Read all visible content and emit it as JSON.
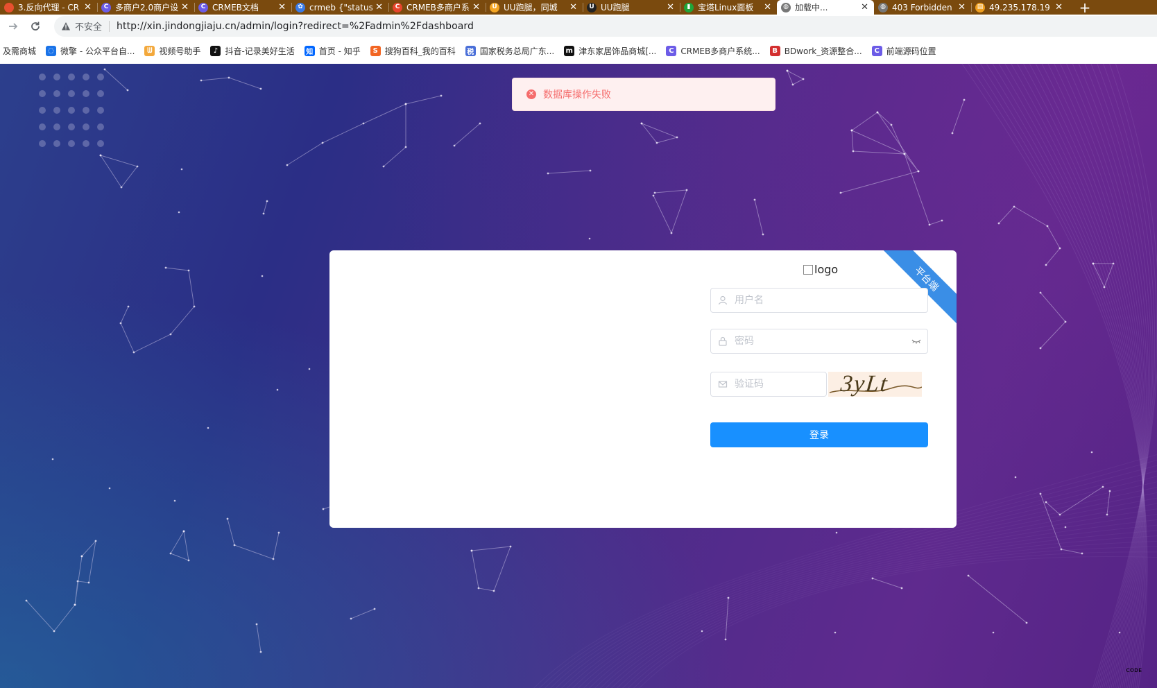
{
  "browser": {
    "tabs": [
      {
        "title": "3.反向代理 - CR",
        "icon": "crmeb-icon",
        "color": "#e8502f",
        "glyph": "",
        "active": false
      },
      {
        "title": "多商户2.0商户设",
        "icon": "crmeb-icon",
        "color": "#6c5ce7",
        "glyph": "C",
        "active": false
      },
      {
        "title": "CRMEB文档",
        "icon": "crmeb-icon",
        "color": "#6c5ce7",
        "glyph": "C",
        "active": false
      },
      {
        "title": "crmeb {\"status",
        "icon": "paw-icon",
        "color": "#3b7be6",
        "glyph": "✿",
        "active": false
      },
      {
        "title": "CRMEB多商户系",
        "icon": "crmeb-icon",
        "color": "#e8452c",
        "glyph": "C",
        "active": false
      },
      {
        "title": "UU跑腿，同城",
        "icon": "uu-icon",
        "color": "#f5a623",
        "glyph": "U",
        "active": false
      },
      {
        "title": "UU跑腿",
        "icon": "uu-icon",
        "color": "#222222",
        "glyph": "U",
        "active": false
      },
      {
        "title": "宝塔Linux面板",
        "icon": "baota-icon",
        "color": "#20a53a",
        "glyph": "▮",
        "active": false
      },
      {
        "title": "加载中...",
        "icon": "globe-icon",
        "color": "#777777",
        "glyph": "◍",
        "active": true
      },
      {
        "title": "403 Forbidden",
        "icon": "globe-icon",
        "color": "#777777",
        "glyph": "◍",
        "active": false
      },
      {
        "title": "49.235.178.19",
        "icon": "server-icon",
        "color": "#f0a020",
        "glyph": "▤",
        "active": false
      }
    ],
    "new_tab": "+",
    "tab_close": "✕",
    "insecure_label": "不安全",
    "url": "http://xin.jindongjiaju.cn/admin/login?redirect=%2Fadmin%2Fdashboard",
    "bookmarks": [
      {
        "label": "及需商城",
        "icon": "",
        "color": ""
      },
      {
        "label": "微擎 - 公众平台自...",
        "icon": "weiqing-icon",
        "color": "#1a73e8",
        "glyph": "◌"
      },
      {
        "label": "视频号助手",
        "icon": "channels-icon",
        "color": "#f3a83b",
        "glyph": "ᗯ"
      },
      {
        "label": "抖音-记录美好生活",
        "icon": "douyin-icon",
        "color": "#111111",
        "glyph": "♪"
      },
      {
        "label": "首页 - 知乎",
        "icon": "zhihu-icon",
        "color": "#0066ff",
        "glyph": "知"
      },
      {
        "label": "搜狗百科_我的百科",
        "icon": "sogou-icon",
        "color": "#f26522",
        "glyph": "S"
      },
      {
        "label": "国家税务总局广东...",
        "icon": "tax-icon",
        "color": "#4a6fd8",
        "glyph": "税"
      },
      {
        "label": "津东家居饰品商城[...",
        "icon": "shop-icon",
        "color": "#111111",
        "glyph": "m"
      },
      {
        "label": "CRMEB多商户系统...",
        "icon": "crmeb-icon",
        "color": "#6c5ce7",
        "glyph": "C"
      },
      {
        "label": "BDwork_资源整合...",
        "icon": "bdwork-icon",
        "color": "#d32f2f",
        "glyph": "B"
      },
      {
        "label": "前端源码位置",
        "icon": "crmeb-icon",
        "color": "#6c5ce7",
        "glyph": "C"
      }
    ]
  },
  "alert": {
    "message": "数据库操作失败",
    "icon": "error-circle-icon",
    "color": "#f56c6c"
  },
  "login": {
    "ribbon": "平台端",
    "logo_text": "logo",
    "username_placeholder": "用户名",
    "password_placeholder": "密码",
    "captcha_placeholder": "验证码",
    "captcha_text": "3yLt",
    "submit_label": "登录",
    "accent_color": "#1890ff"
  },
  "corner_badge": "ᴄᴏᴅᴇ"
}
